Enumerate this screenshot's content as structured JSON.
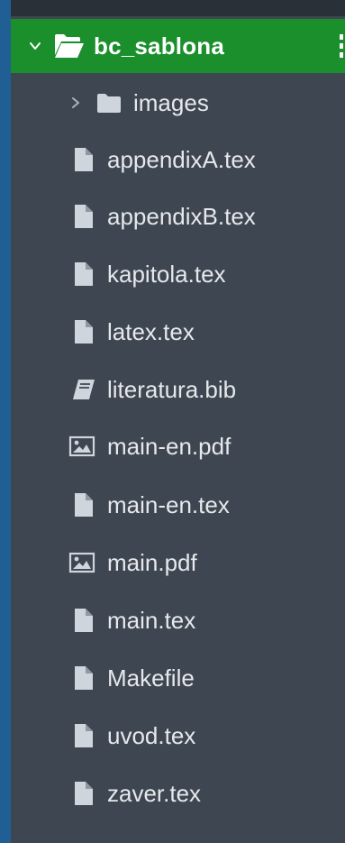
{
  "tree": {
    "root": {
      "label": "bc_sablona",
      "expanded": true,
      "icon": "folder-open-icon",
      "highlight_color": "#1a8f2c"
    },
    "items": [
      {
        "label": "images",
        "type": "folder",
        "icon": "folder-icon",
        "collapsed": true
      },
      {
        "label": "appendixA.tex",
        "type": "file",
        "icon": "file-icon"
      },
      {
        "label": "appendixB.tex",
        "type": "file",
        "icon": "file-icon"
      },
      {
        "label": "kapitola.tex",
        "type": "file",
        "icon": "file-icon"
      },
      {
        "label": "latex.tex",
        "type": "file",
        "icon": "file-icon"
      },
      {
        "label": "literatura.bib",
        "type": "book",
        "icon": "book-icon"
      },
      {
        "label": "main-en.pdf",
        "type": "image",
        "icon": "image-icon"
      },
      {
        "label": "main-en.tex",
        "type": "file",
        "icon": "file-icon"
      },
      {
        "label": "main.pdf",
        "type": "image",
        "icon": "image-icon"
      },
      {
        "label": "main.tex",
        "type": "file",
        "icon": "file-icon"
      },
      {
        "label": "Makefile",
        "type": "file",
        "icon": "file-icon"
      },
      {
        "label": "uvod.tex",
        "type": "file",
        "icon": "file-icon"
      },
      {
        "label": "zaver.tex",
        "type": "file",
        "icon": "file-icon"
      }
    ]
  },
  "colors": {
    "background": "#3e4651",
    "text": "#e6e9ec",
    "icon": "#cfd5dc",
    "accent_strip": "#1f5f93"
  }
}
